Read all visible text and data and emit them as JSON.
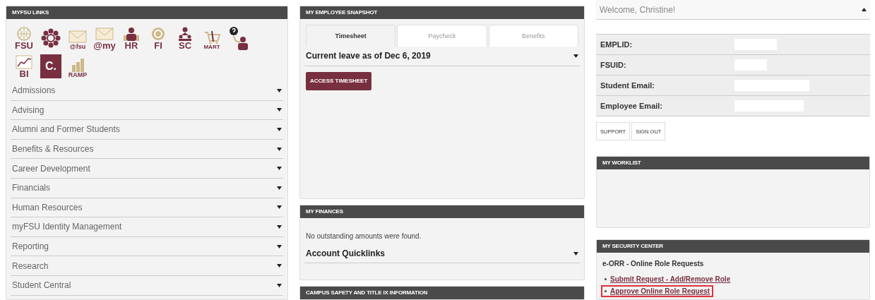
{
  "links_panel": {
    "title": "MYFSU LINKS",
    "icons": [
      {
        "kind": "globe",
        "label": "FSU"
      },
      {
        "kind": "ring"
      },
      {
        "kind": "mail",
        "label": "@fsu"
      },
      {
        "kind": "mail",
        "label": "@my"
      },
      {
        "kind": "person",
        "label": "HR"
      },
      {
        "kind": "coin",
        "label": "FI"
      },
      {
        "kind": "people",
        "label": "SC"
      },
      {
        "kind": "cart",
        "label": "MART"
      },
      {
        "kind": "help"
      },
      {
        "kind": "chart",
        "label": "BI"
      },
      {
        "kind": "tile",
        "label": "C."
      },
      {
        "kind": "bars",
        "label": "RAMP"
      }
    ],
    "items": [
      {
        "label": "Admissions",
        "expanded": false
      },
      {
        "label": "Advising",
        "expanded": false
      },
      {
        "label": "Alumni and Former Students",
        "expanded": false
      },
      {
        "label": "Benefits & Resources",
        "expanded": false
      },
      {
        "label": "Career Development",
        "expanded": false
      },
      {
        "label": "Financials",
        "expanded": false
      },
      {
        "label": "Human Resources",
        "expanded": false
      },
      {
        "label": "myFSU Identity Management",
        "expanded": false
      },
      {
        "label": "Reporting",
        "expanded": false
      },
      {
        "label": "Research",
        "expanded": false
      },
      {
        "label": "Student Central",
        "expanded": false
      }
    ]
  },
  "snapshot": {
    "title": "MY EMPLOYEE SNAPSHOT",
    "tabs": [
      {
        "label": "Timesheet",
        "selected": true
      },
      {
        "label": "Paycheck",
        "selected": false
      },
      {
        "label": "Benefits",
        "selected": false
      }
    ],
    "section": {
      "label": "Current leave as of Dec 6, 2019",
      "expanded": false
    },
    "button": "ACCESS TIMESHEET"
  },
  "finances": {
    "title": "MY FINANCES",
    "message": "No outstanding amounts were found.",
    "section": {
      "label": "Account Quicklinks",
      "expanded": false
    }
  },
  "campus_safety": {
    "title": "CAMPUS SAFETY AND TITLE IX INFORMATION"
  },
  "profile": {
    "welcome": "Welcome, Christine!",
    "expanded": true,
    "fields": [
      {
        "label": "EMPLID:"
      },
      {
        "label": "FSUID:"
      },
      {
        "label": "Student Email:"
      },
      {
        "label": "Employee Email:"
      }
    ],
    "buttons": [
      "SUPPORT",
      "SIGN OUT"
    ]
  },
  "worklist": {
    "title": "MY WORKLIST"
  },
  "security": {
    "title": "MY SECURITY CENTER",
    "heading": "e-ORR - Online Role Requests",
    "links": [
      {
        "label": "Submit Request - Add/Remove Role",
        "highlighted": false
      },
      {
        "label": "Approve Online Role Request",
        "highlighted": true
      }
    ]
  }
}
